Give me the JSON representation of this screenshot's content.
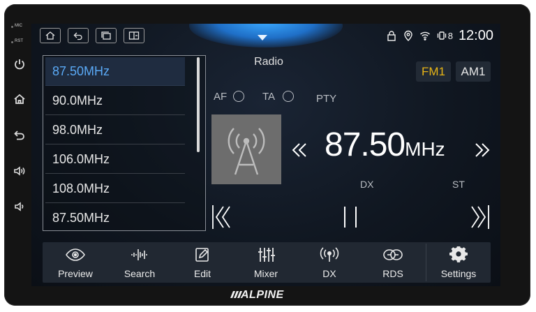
{
  "device": {
    "brand": "ALPINE",
    "side_labels": [
      "MIC",
      "RST"
    ],
    "side_buttons": [
      "power-icon",
      "home-icon",
      "back-icon",
      "volume-up-icon",
      "volume-down-icon"
    ]
  },
  "screen": {
    "title": "Radio",
    "status": {
      "clock": "12:00",
      "battery_label": "8"
    },
    "bands": {
      "fm": "FM1",
      "am": "AM1",
      "active": "FM1"
    },
    "options": {
      "af": "AF",
      "ta": "TA",
      "pty": "PTY"
    },
    "frequency_list": [
      {
        "label": "87.50MHz",
        "active": true
      },
      {
        "label": "90.0MHz",
        "active": false
      },
      {
        "label": "98.0MHz",
        "active": false
      },
      {
        "label": "106.0MHz",
        "active": false
      },
      {
        "label": "108.0MHz",
        "active": false
      },
      {
        "label": "87.50MHz",
        "active": false
      }
    ],
    "current": {
      "value": "87.50",
      "unit": "MHz",
      "dx": "DX",
      "st": "ST"
    },
    "bottom_bar": [
      {
        "label": "Preview",
        "icon": "eye-icon"
      },
      {
        "label": "Search",
        "icon": "waveform-icon"
      },
      {
        "label": "Edit",
        "icon": "edit-icon"
      },
      {
        "label": "Mixer",
        "icon": "mixer-icon"
      },
      {
        "label": "DX",
        "icon": "broadcast-icon"
      },
      {
        "label": "RDS",
        "icon": "rds-icon"
      },
      {
        "label": "Settings",
        "icon": "gear-icon"
      }
    ],
    "colors": {
      "active_band": "#e8b516",
      "active_item": "#5aa9f5",
      "accent_glow": "#3aa9ff"
    }
  }
}
